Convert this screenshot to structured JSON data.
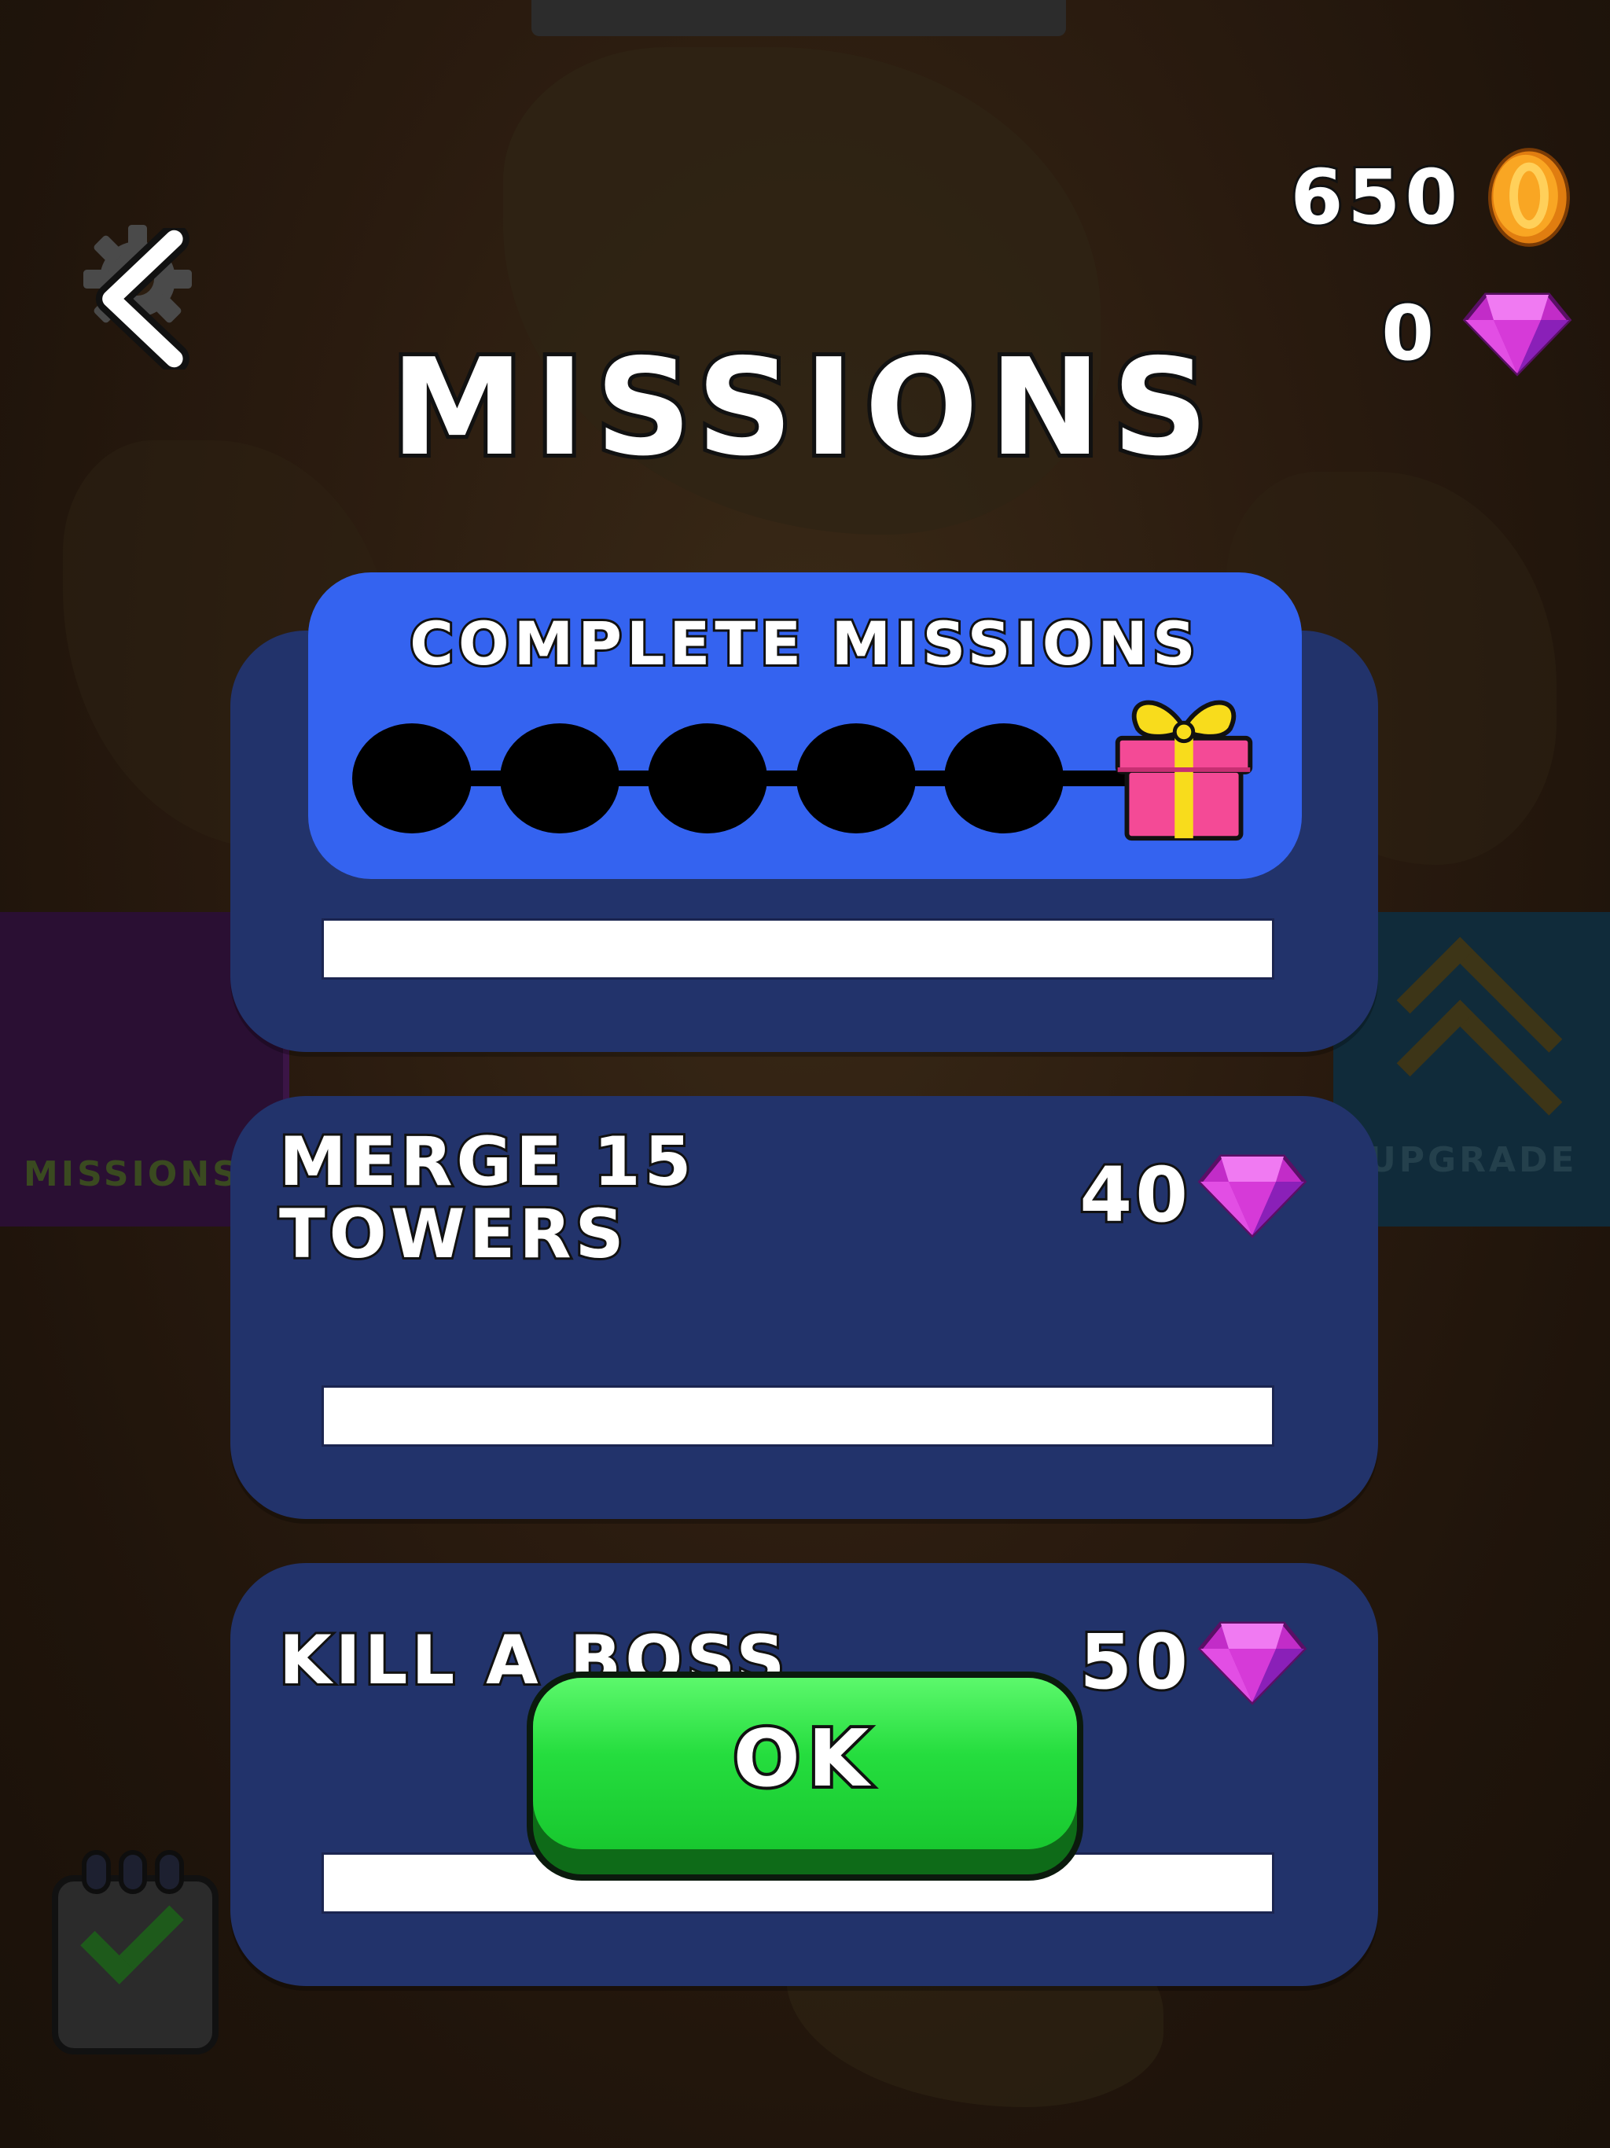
{
  "header": {
    "title": "MISSIONS",
    "coins": "650",
    "gems": "0"
  },
  "complete_panel": {
    "title": "COMPLETE MISSIONS",
    "steps_completed": 0,
    "steps_total": 5,
    "reward_icon": "gift-icon"
  },
  "missions": [
    {
      "title": "",
      "reward": "",
      "progress": 0
    },
    {
      "title": "MERGE 15\nTOWERS",
      "reward": "40",
      "progress": 0
    },
    {
      "title": "KILL A BOSS",
      "reward": "50",
      "progress": 0
    }
  ],
  "background": {
    "left_tile_label": "MISSIONS",
    "right_tile_label": "UPGRADE"
  },
  "buttons": {
    "ok_label": "OK"
  },
  "colors": {
    "card": "#22336b",
    "panel": "#3463f0",
    "ok_green": "#25dd3e",
    "gem": "#d63ad8",
    "coin": "#f9a623"
  }
}
